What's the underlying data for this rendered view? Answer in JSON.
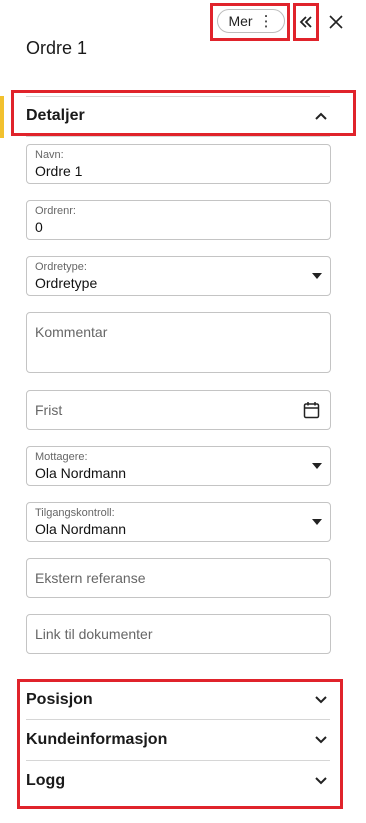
{
  "header": {
    "title": "Ordre 1",
    "more_label": "Mer",
    "more_dots": "⋮"
  },
  "sections": {
    "detaljer": "Detaljer",
    "posisjon": "Posisjon",
    "kundeinformasjon": "Kundeinformasjon",
    "logg": "Logg"
  },
  "fields": {
    "navn": {
      "label": "Navn:",
      "value": "Ordre 1"
    },
    "ordrenr": {
      "label": "Ordrenr:",
      "value": "0"
    },
    "ordretype": {
      "label": "Ordretype:",
      "value": "Ordretype"
    },
    "kommentar": {
      "placeholder": "Kommentar"
    },
    "frist": {
      "placeholder": "Frist"
    },
    "mottagere": {
      "label": "Mottagere:",
      "value": "Ola Nordmann"
    },
    "tilgangskontroll": {
      "label": "Tilgangskontroll:",
      "value": "Ola Nordmann"
    },
    "ekstern_referanse": {
      "placeholder": "Ekstern referanse"
    },
    "link_dokumenter": {
      "placeholder": "Link til dokumenter"
    }
  },
  "icons": {
    "more": "vertical-dots-icon",
    "collapse": "double-chevron-left-icon",
    "close": "close-icon",
    "calendar": "calendar-icon",
    "expand": "chevron-down-icon",
    "collapse_section": "chevron-up-icon",
    "dropdown": "caret-down-icon"
  },
  "colors": {
    "highlight": "#e0232b",
    "accent": "#f2c12e"
  }
}
